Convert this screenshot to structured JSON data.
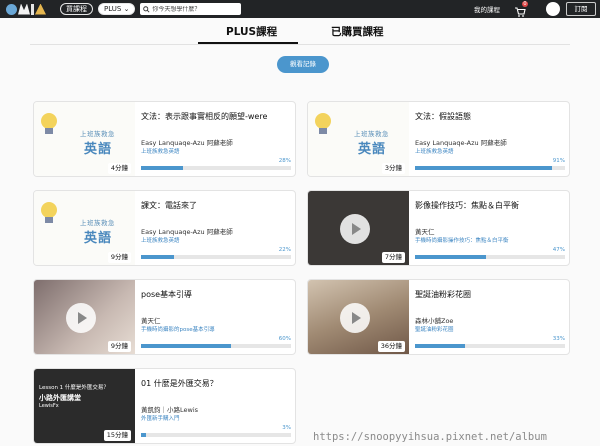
{
  "nav": {
    "search_placeholder": "你今天想學什麼？",
    "buy_courses": "買課程",
    "plus": "PLUS",
    "my_courses": "我的課程",
    "cart_count": "0",
    "subscribe": "訂閱"
  },
  "tabs": [
    {
      "label": "PLUS課程",
      "active": true
    },
    {
      "label": "已購買課程",
      "active": false
    }
  ],
  "history_button": "觀看記錄",
  "courses": [
    {
      "title": "文法：表示跟事實相反的願望-were",
      "author": "Easy Lanquaqe-Azu 阿蘇老師",
      "channel": "上班族救急英語",
      "duration": "4分鐘",
      "progress": 28,
      "progress_label": "28%",
      "thumb_caption1": "上班族救急",
      "thumb_caption2": "英語"
    },
    {
      "title": "文法：假設語態",
      "author": "Easy Lanquaqe-Azu 阿蘇老師",
      "channel": "上班族救急英語",
      "duration": "3分鐘",
      "progress": 91,
      "progress_label": "91%",
      "thumb_caption1": "上班族救急",
      "thumb_caption2": "英語"
    },
    {
      "title": "課文：電話來了",
      "author": "Easy Lanquaqe-Azu 阿蘇老師",
      "channel": "上班族救急英語",
      "duration": "9分鐘",
      "progress": 22,
      "progress_label": "22%",
      "thumb_caption1": "上班族救急",
      "thumb_caption2": "英語"
    },
    {
      "title": "影像操作技巧：焦點＆白平衡",
      "author": "黃天仁",
      "channel": "手機時尚攝影操作技巧：焦點＆白平衡",
      "duration": "7分鐘",
      "progress": 47,
      "progress_label": "47%"
    },
    {
      "title": "pose基本引導",
      "author": "黃天仁",
      "channel": "手機時尚攝影的pose基本引導",
      "duration": "9分鐘",
      "progress": 60,
      "progress_label": "60%"
    },
    {
      "title": "聖誕油粉彩花圈",
      "author": "森林小舖Zoe",
      "channel": "聖誕油粉彩花圈",
      "duration": "36分鐘",
      "progress": 33,
      "progress_label": "33%"
    },
    {
      "title": "01 什麼是外匯交易？",
      "author": "黃凱鈞｜小路Lewis",
      "channel": "外匯新手購入門",
      "duration": "15分鐘",
      "progress": 3,
      "progress_label": "3%",
      "cover_line1": "Lesson 1 什麼是外匯交易？",
      "cover_line2": "小路外匯講堂",
      "cover_line3": "LewisFx"
    }
  ],
  "watermark": "https://snoopyyihsua.pixnet.net/album",
  "colors": {
    "accent": "#4b96cd",
    "navbar": "#222426"
  }
}
